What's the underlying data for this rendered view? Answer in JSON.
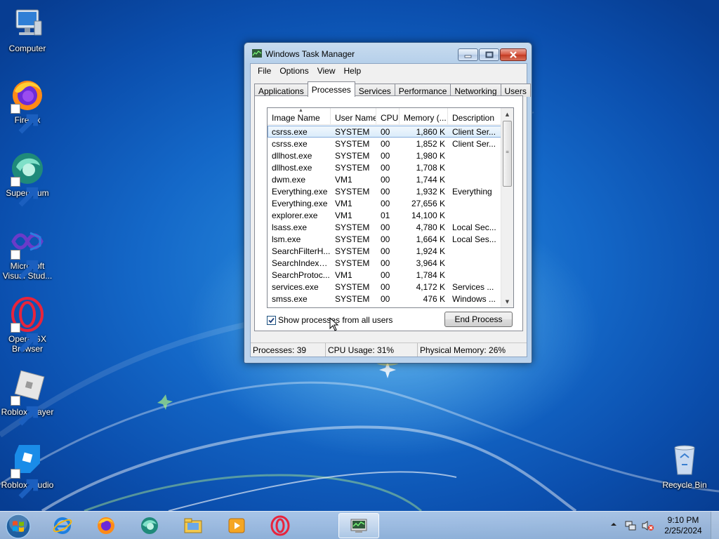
{
  "desktop": {
    "icons": [
      {
        "label": "Computer"
      },
      {
        "label": "Firefox"
      },
      {
        "label": "Supermium"
      },
      {
        "label": "Microsoft Visual Stud..."
      },
      {
        "label": "Opera GX Browser"
      },
      {
        "label": "Roblox Player"
      },
      {
        "label": "Roblox Studio"
      },
      {
        "label": "Recycle Bin"
      }
    ]
  },
  "window": {
    "title": "Windows Task Manager",
    "menu": [
      "File",
      "Options",
      "View",
      "Help"
    ],
    "tabs": [
      "Applications",
      "Processes",
      "Services",
      "Performance",
      "Networking",
      "Users"
    ],
    "active_tab": "Processes",
    "columns": [
      "Image Name",
      "User Name",
      "CPU",
      "Memory (...",
      "Description"
    ],
    "rows": [
      [
        "csrss.exe",
        "SYSTEM",
        "00",
        "1,860 K",
        "Client Ser..."
      ],
      [
        "csrss.exe",
        "SYSTEM",
        "00",
        "1,852 K",
        "Client Ser..."
      ],
      [
        "dllhost.exe",
        "SYSTEM",
        "00",
        "1,980 K",
        ""
      ],
      [
        "dllhost.exe",
        "SYSTEM",
        "00",
        "1,708 K",
        ""
      ],
      [
        "dwm.exe",
        "VM1",
        "00",
        "1,744 K",
        ""
      ],
      [
        "Everything.exe",
        "SYSTEM",
        "00",
        "1,932 K",
        "Everything"
      ],
      [
        "Everything.exe",
        "VM1",
        "00",
        "27,656 K",
        ""
      ],
      [
        "explorer.exe",
        "VM1",
        "01",
        "14,100 K",
        ""
      ],
      [
        "lsass.exe",
        "SYSTEM",
        "00",
        "4,780 K",
        "Local Sec..."
      ],
      [
        "lsm.exe",
        "SYSTEM",
        "00",
        "1,664 K",
        "Local Ses..."
      ],
      [
        "SearchFilterH...",
        "SYSTEM",
        "00",
        "1,924 K",
        ""
      ],
      [
        "SearchIndexe...",
        "SYSTEM",
        "00",
        "3,964 K",
        ""
      ],
      [
        "SearchProtoc...",
        "VM1",
        "00",
        "1,784 K",
        ""
      ],
      [
        "services.exe",
        "SYSTEM",
        "00",
        "4,172 K",
        "Services ..."
      ],
      [
        "smss.exe",
        "SYSTEM",
        "00",
        "476 K",
        "Windows ..."
      ]
    ],
    "selected_row": 0,
    "show_all_label": "Show processes from all users",
    "show_all_checked": true,
    "end_process_label": "End Process",
    "status": {
      "processes": "Processes: 39",
      "cpu": "CPU Usage: 31%",
      "memory": "Physical Memory: 26%"
    }
  },
  "taskbar": {
    "pinned": [
      "internet-explorer-icon",
      "firefox-icon",
      "supermium-icon",
      "windows-explorer-icon",
      "media-player-icon",
      "opera-gx-icon",
      "task-manager-icon"
    ],
    "clock_time": "9:10 PM",
    "clock_date": "2/25/2024"
  }
}
